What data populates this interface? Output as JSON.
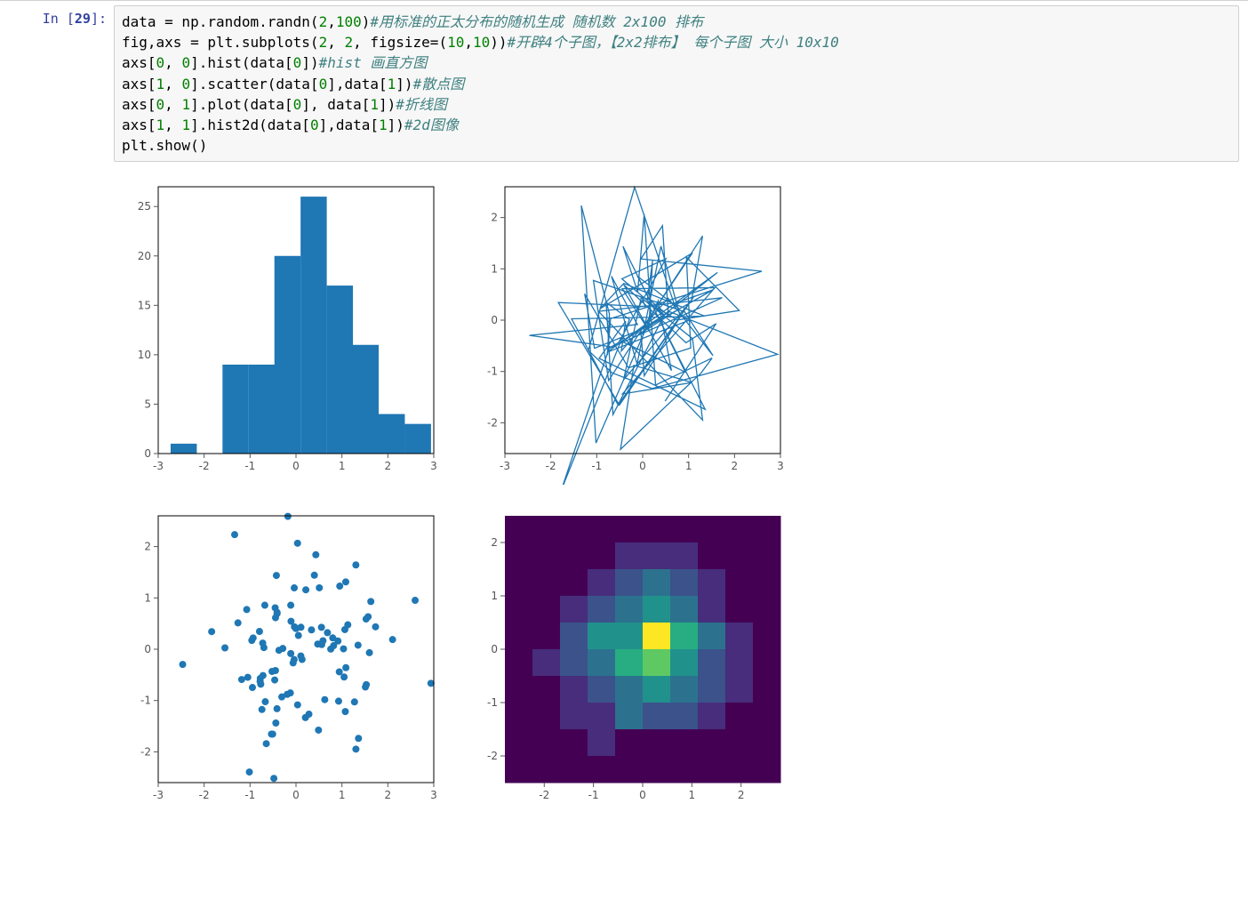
{
  "cell": {
    "prompt_label": "In [",
    "prompt_num": "29",
    "prompt_close": "]:",
    "code_lines": [
      {
        "raw": "data = np.random.randn(2,100)#用标准的正太分布的随机生成 随机数 2x100 排布"
      },
      {
        "raw": "fig,axs = plt.subplots(2, 2, figsize=(10,10))#开辟4个子图，【2x2排布】 每个子图 大小 10x10"
      },
      {
        "raw": "axs[0, 0].hist(data[0])#hist 画直方图"
      },
      {
        "raw": "axs[1, 0].scatter(data[0],data[1])#散点图"
      },
      {
        "raw": "axs[0, 1].plot(data[0], data[1])#折线图"
      },
      {
        "raw": "axs[1, 1].hist2d(data[0],data[1])#2d图像"
      },
      {
        "raw": "plt.show()"
      }
    ]
  },
  "chart_data": [
    {
      "type": "bar",
      "position": "0,0",
      "description": "histogram of data[0]",
      "x": [
        -2.73,
        -2.17,
        -1.6,
        -1.03,
        -0.47,
        0.1,
        0.67,
        1.23,
        1.8,
        2.37
      ],
      "binwidth": 0.57,
      "values": [
        1,
        0,
        9,
        9,
        20,
        26,
        17,
        11,
        4,
        3
      ],
      "xticks": [
        -3,
        -2,
        -1,
        0,
        1,
        2,
        3
      ],
      "yticks": [
        0,
        5,
        10,
        15,
        20,
        25
      ],
      "xlim": [
        -3,
        3
      ],
      "ylim": [
        0,
        27
      ],
      "color": "#1f77b4"
    },
    {
      "type": "line",
      "position": "0,1",
      "description": "plot(data[0], data[1]) tangled line",
      "xticks": [
        -3,
        -2,
        -1,
        0,
        1,
        2,
        3
      ],
      "yticks": [
        -2,
        -1,
        0,
        1,
        2
      ],
      "xlim": [
        -3,
        3
      ],
      "ylim": [
        -2.6,
        2.6
      ],
      "color": "#1f77b4",
      "note": "random lines between 100 standard-normal (x,y) pairs"
    },
    {
      "type": "scatter",
      "position": "1,0",
      "description": "scatter(data[0], data[1])",
      "xticks": [
        -3,
        -2,
        -1,
        0,
        1,
        2,
        3
      ],
      "yticks": [
        -2,
        -1,
        0,
        1,
        2
      ],
      "xlim": [
        -3,
        3
      ],
      "ylim": [
        -2.6,
        2.6
      ],
      "color": "#1f77b4",
      "note": "100 standard-normal (x,y) points"
    },
    {
      "type": "heatmap",
      "position": "1,1",
      "description": "hist2d(data[0], data[1]) viridis",
      "xticks": [
        -2,
        -1,
        0,
        1,
        2
      ],
      "yticks": [
        -2,
        -1,
        0,
        1,
        2
      ],
      "xlim": [
        -2.8,
        2.8
      ],
      "ylim": [
        -2.5,
        2.5
      ],
      "colormap": "viridis",
      "grid_size": [
        10,
        10
      ],
      "counts": [
        [
          0,
          0,
          0,
          0,
          0,
          0,
          0,
          0,
          0,
          0
        ],
        [
          0,
          0,
          0,
          1,
          0,
          0,
          0,
          0,
          0,
          0
        ],
        [
          0,
          0,
          1,
          1,
          3,
          2,
          2,
          1,
          0,
          0
        ],
        [
          0,
          0,
          1,
          2,
          3,
          4,
          3,
          2,
          1,
          0
        ],
        [
          0,
          1,
          2,
          3,
          5,
          6,
          4,
          2,
          1,
          0
        ],
        [
          0,
          0,
          2,
          4,
          4,
          7,
          5,
          3,
          1,
          0
        ],
        [
          0,
          0,
          1,
          2,
          3,
          4,
          3,
          1,
          0,
          0
        ],
        [
          0,
          0,
          0,
          1,
          2,
          3,
          2,
          1,
          0,
          0
        ],
        [
          0,
          0,
          0,
          0,
          1,
          1,
          1,
          0,
          0,
          0
        ],
        [
          0,
          0,
          0,
          0,
          0,
          0,
          0,
          0,
          0,
          0
        ]
      ]
    }
  ],
  "colors": {
    "mpl_blue": "#1f77b4",
    "viridis": [
      "#440154",
      "#472d7b",
      "#3b528b",
      "#2c728e",
      "#21918c",
      "#27ad81",
      "#5ec962",
      "#aadc32",
      "#fde725"
    ]
  }
}
